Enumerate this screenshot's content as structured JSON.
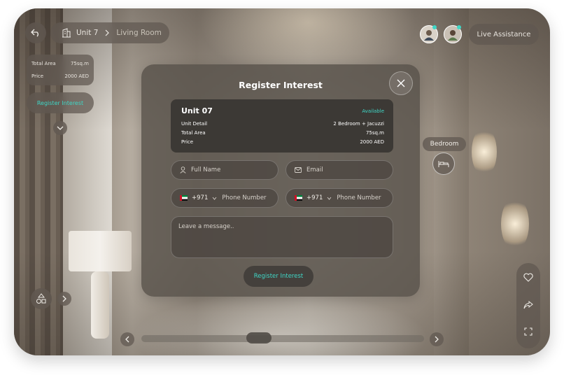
{
  "header": {
    "back_icon": "undo-arrow-icon",
    "building_icon": "building-icon",
    "unit_label": "Unit 7",
    "separator_icon": "chevron-right-icon",
    "room_label": "Living Room",
    "live_assistance_label": "Live Assistance"
  },
  "info_card": {
    "total_area_label": "Total Area",
    "total_area_value": "75sq.m",
    "price_label": "Price",
    "price_value": "2000 AED",
    "register_label": "Register Interest"
  },
  "hotspot": {
    "label": "Bedroom",
    "icon": "bed-icon"
  },
  "modal": {
    "title": "Register Interest",
    "unit": {
      "name": "Unit 07",
      "status": "Available",
      "rows": [
        {
          "label": "Unit Detail",
          "value": "2 Bedroom + Jacuzzi"
        },
        {
          "label": "Total Area",
          "value": "75sq.m"
        },
        {
          "label": "Price",
          "value": "2000 AED"
        }
      ]
    },
    "full_name_placeholder": "Full Name",
    "email_placeholder": "Email",
    "phone_code_1": "+971",
    "phone_placeholder_1": "Phone Number",
    "phone_code_2": "+971",
    "phone_placeholder_2": "Phone Number",
    "message_placeholder": "Leave a message..",
    "submit_label": "Register Interest"
  },
  "right_toolbar": [
    "heart-icon",
    "share-icon",
    "fullscreen-icon"
  ],
  "colors": {
    "accent": "#3fd6c6",
    "panel": "#58524b",
    "status": "#3fd6c6"
  }
}
